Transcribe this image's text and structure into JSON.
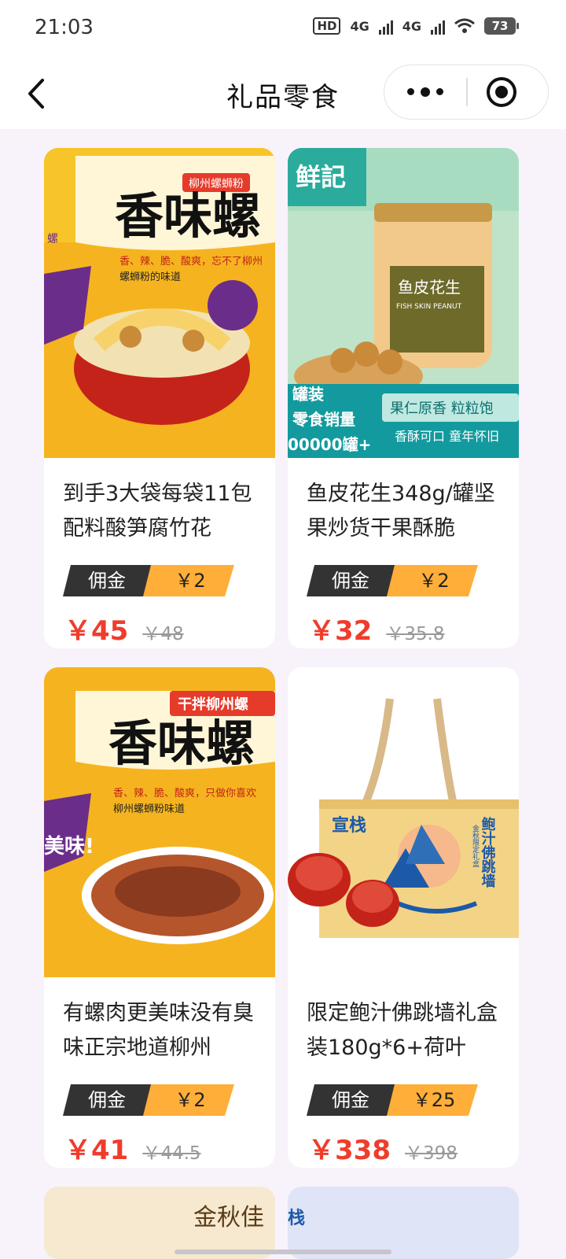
{
  "status": {
    "time": "21:03",
    "hd": "HD",
    "net1": "4G",
    "net2": "4G",
    "battery": "73"
  },
  "nav": {
    "title": "礼品零食"
  },
  "products": [
    {
      "image_text": "香味螺",
      "image_tag": "柳州螺蛳粉",
      "image_line": "香、辣、脆、酸爽，忘不了柳州",
      "image_line2": "螺蛳粉的味道",
      "title": "到手3大袋每袋11包配料酸笋腐竹花",
      "commission_label": "佣金",
      "commission": "￥2",
      "price": "￥45",
      "orig_price": "￥48"
    },
    {
      "image_text": "鱼皮花生",
      "image_tag": "FISH SKIN PEANUT",
      "image_line": "果仁原香 粒粒饱",
      "image_line2": "香酥可口 童年怀旧",
      "title": "鱼皮花生348g/罐坚果炒货干果酥脆",
      "commission_label": "佣金",
      "commission": "￥2",
      "price": "￥32",
      "orig_price": "￥35.8"
    },
    {
      "image_text": "香味螺",
      "image_tag": "干拌柳州螺",
      "image_line": "香、辣、脆、酸爽，只做你喜欢",
      "image_line2": "柳州螺蛳粉味道",
      "title": "有螺肉更美味没有臭味正宗地道柳州",
      "commission_label": "佣金",
      "commission": "￥2",
      "price": "￥41",
      "orig_price": "￥44.5"
    },
    {
      "image_text": "鲍汁佛跳墙",
      "image_tag": "宣栈",
      "image_line": "金秋限定礼盒",
      "image_line2": "",
      "title": "限定鲍汁佛跳墙礼盒装180g*6+荷叶",
      "commission_label": "佣金",
      "commission": "￥25",
      "price": "￥338",
      "orig_price": "￥398"
    }
  ],
  "partial": {
    "left_text": "金秋佳",
    "right_text": "栈"
  },
  "colors": {
    "price": "#f03c2b",
    "commission_dark": "#333333",
    "commission_orange": "#ffae3a",
    "background": "#f8f2fb"
  }
}
